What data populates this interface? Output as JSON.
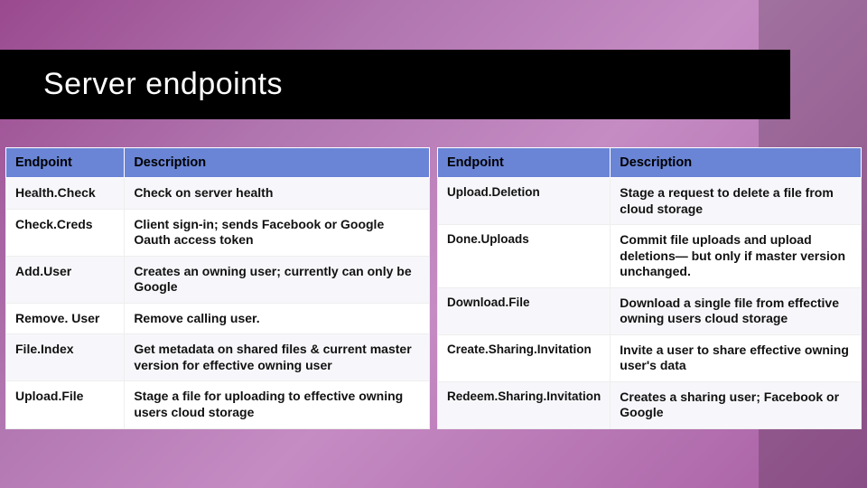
{
  "title": "Server endpoints",
  "left_table": {
    "headers": {
      "endpoint": "Endpoint",
      "description": "Description"
    },
    "rows": [
      {
        "ep": "Health.Check",
        "desc": "Check on server health"
      },
      {
        "ep": "Check.Creds",
        "desc": "Client sign-in; sends Facebook or Google Oauth access token"
      },
      {
        "ep": "Add.User",
        "desc": "Creates an owning user; currently can only be Google"
      },
      {
        "ep": "Remove. User",
        "desc": "Remove calling user."
      },
      {
        "ep": "File.Index",
        "desc": "Get metadata on shared files & current master version for effective owning user"
      },
      {
        "ep": "Upload.File",
        "desc": "Stage a file for uploading to effective owning users cloud storage"
      }
    ]
  },
  "right_table": {
    "headers": {
      "endpoint": "Endpoint",
      "description": "Description"
    },
    "rows": [
      {
        "ep": "Upload.Deletion",
        "desc": "Stage a request to delete a file from cloud storage"
      },
      {
        "ep": "Done.Uploads",
        "desc": "Commit file uploads and upload deletions— but only if master version unchanged."
      },
      {
        "ep": "Download.File",
        "desc": "Download a single file from effective owning users cloud storage"
      },
      {
        "ep": "Create.Sharing.Invitation",
        "desc": "Invite a user to share effective owning user's data"
      },
      {
        "ep": "Redeem.Sharing.Invitation",
        "desc": "Creates a sharing user; Facebook or Google"
      }
    ]
  }
}
